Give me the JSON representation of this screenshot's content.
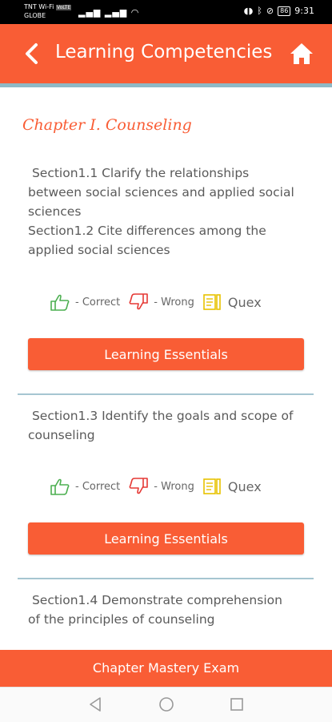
{
  "status": {
    "carrier_line1": "TNT Wi-Fi",
    "carrier_line2": "GLOBE",
    "volte": "VoLTE",
    "battery": "86",
    "time": "9:31"
  },
  "header": {
    "title": "Learning Competencies",
    "back_icon": "chevron-left-icon",
    "home_icon": "home-icon"
  },
  "chapter": {
    "title": "Chapter I. Counseling"
  },
  "groups": [
    {
      "lines": [
        " Section1.1 Clarify the relationships\nbetween social sciences and applied social\nsciences",
        "Section1.2 Cite differences among the\napplied social sciences"
      ],
      "correct_label": "- Correct",
      "wrong_label": "- Wrong",
      "quex_label": "Quex",
      "button_label": "Learning Essentials"
    },
    {
      "lines": [
        " Section1.3 Identify the goals and scope of\ncounseling"
      ],
      "correct_label": "- Correct",
      "wrong_label": "- Wrong",
      "quex_label": "Quex",
      "button_label": "Learning Essentials"
    },
    {
      "lines": [
        " Section1.4 Demonstrate comprehension\nof the principles of counseling"
      ]
    }
  ],
  "footer": {
    "exam_label": "Chapter Mastery Exam"
  },
  "colors": {
    "accent": "#f95d35",
    "divider": "#a6c6d1",
    "correct": "#4caf50",
    "wrong": "#e53935",
    "quex": "#e8c200"
  }
}
